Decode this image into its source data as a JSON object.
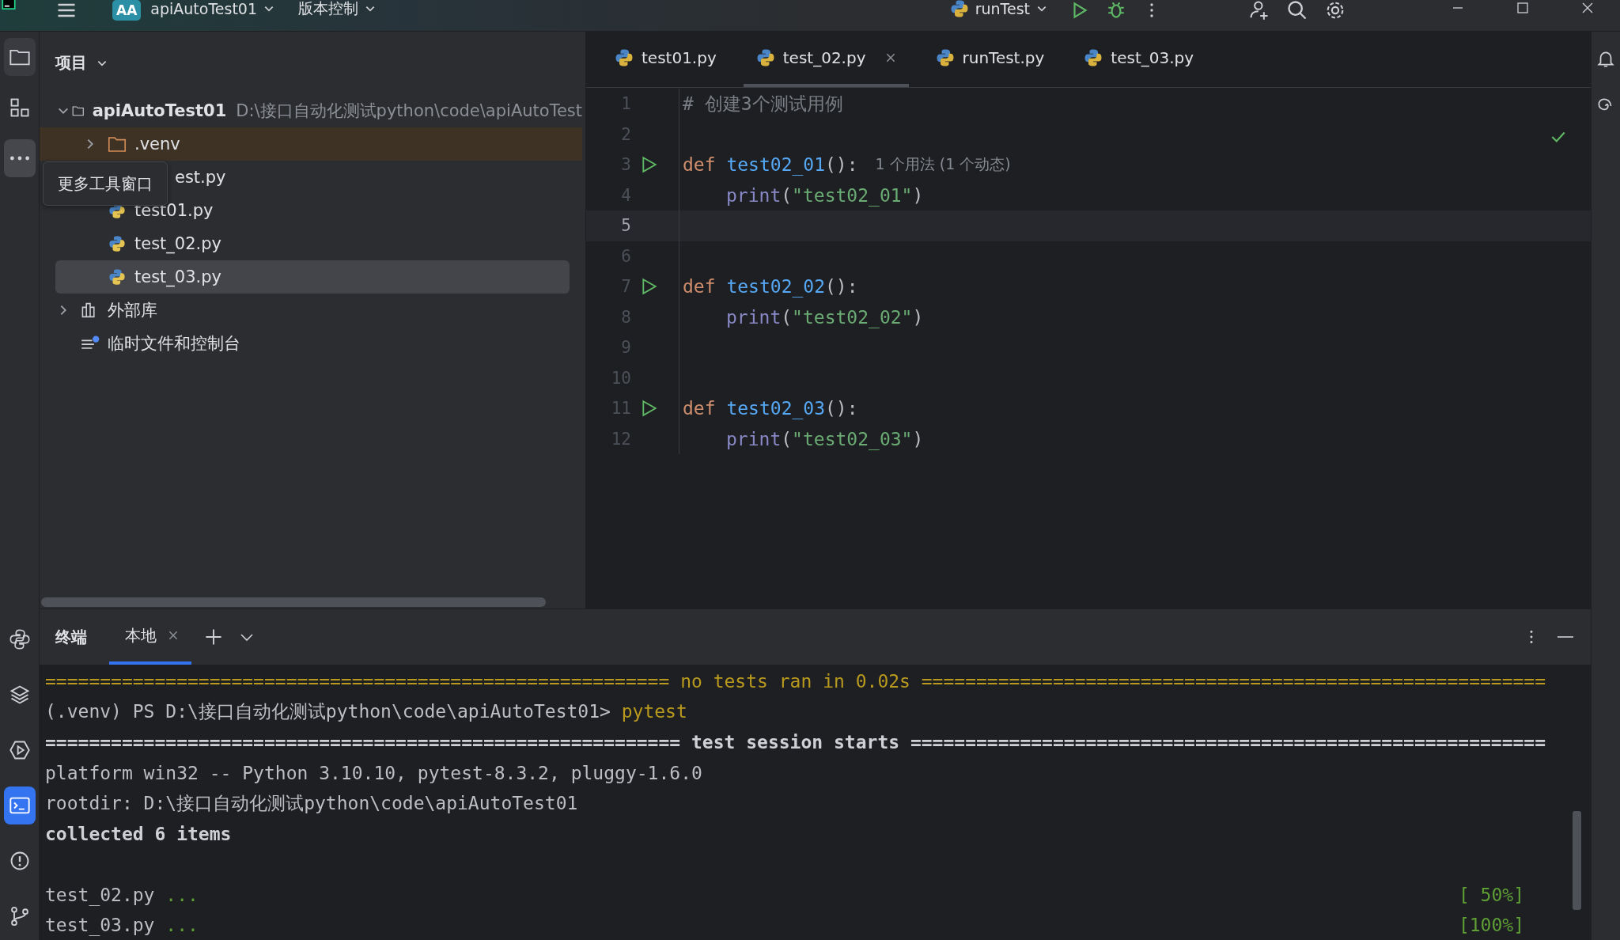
{
  "title_bar": {
    "project_badge": "AA",
    "project": "apiAutoTest01",
    "vcs": "版本控制",
    "run_config": "runTest"
  },
  "tool_strip": {
    "top": [
      {
        "kind": "project",
        "selected": true,
        "hovered": false
      },
      {
        "kind": "structure",
        "selected": false,
        "hovered": false
      },
      {
        "kind": "more",
        "selected": false,
        "hovered": true
      }
    ],
    "bottom": [
      {
        "kind": "python-console",
        "selected": false
      },
      {
        "kind": "layers",
        "selected": false
      },
      {
        "kind": "services",
        "selected": false
      },
      {
        "kind": "terminal",
        "selected": true
      },
      {
        "kind": "problems",
        "selected": false
      },
      {
        "kind": "git",
        "selected": false
      }
    ],
    "tooltip": "更多工具窗口"
  },
  "project": {
    "title": "项目",
    "tree": [
      {
        "label": "apiAutoTest01",
        "path": "D:\\接口自动化测试python\\code\\apiAutoTest",
        "kind": "project",
        "expanded": true,
        "selected": false,
        "children": [
          {
            "label": ".venv",
            "kind": "folder",
            "expanded": false,
            "excluded": true,
            "selected": false
          },
          {
            "label": "est.py",
            "kind": "covered-file",
            "selected": false
          },
          {
            "label": "test01.py",
            "kind": "file",
            "selected": false
          },
          {
            "label": "test_02.py",
            "kind": "file",
            "selected": false
          },
          {
            "label": "test_03.py",
            "kind": "file",
            "selected": true
          }
        ]
      },
      {
        "label": "外部库",
        "kind": "library",
        "expanded": false,
        "selected": false
      },
      {
        "label": "临时文件和控制台",
        "kind": "scratches",
        "selected": false
      }
    ]
  },
  "editor": {
    "tabs": [
      {
        "label": "test01.py",
        "selected": false
      },
      {
        "label": "test_02.py",
        "selected": true
      },
      {
        "label": "runTest.py",
        "selected": false
      },
      {
        "label": "test_03.py",
        "selected": false
      }
    ],
    "lines": [
      {
        "number": "1",
        "tokens": [
          {
            "text": "# 创建3个测试用例",
            "kind": "comment"
          }
        ]
      },
      {
        "number": "2"
      },
      {
        "number": "3",
        "runnable": true,
        "tokens": [
          {
            "text": "def ",
            "kind": "keyword"
          },
          {
            "text": "test02_01",
            "kind": "function"
          },
          {
            "text": "():",
            "kind": "punct"
          }
        ],
        "hint": "1 个用法 (1 个动态)"
      },
      {
        "number": "4",
        "indent": true,
        "tokens": [
          {
            "text": "print",
            "kind": "builtin"
          },
          {
            "text": "(",
            "kind": "punct"
          },
          {
            "text": "\"test02_01\"",
            "kind": "string"
          },
          {
            "text": ")",
            "kind": "punct"
          }
        ]
      },
      {
        "number": "5",
        "current": true
      },
      {
        "number": "6"
      },
      {
        "number": "7",
        "runnable": true,
        "tokens": [
          {
            "text": "def ",
            "kind": "keyword"
          },
          {
            "text": "test02_02",
            "kind": "function"
          },
          {
            "text": "():",
            "kind": "punct"
          }
        ]
      },
      {
        "number": "8",
        "indent": true,
        "tokens": [
          {
            "text": "print",
            "kind": "builtin"
          },
          {
            "text": "(",
            "kind": "punct"
          },
          {
            "text": "\"test02_02\"",
            "kind": "string"
          },
          {
            "text": ")",
            "kind": "punct"
          }
        ]
      },
      {
        "number": "9"
      },
      {
        "number": "10"
      },
      {
        "number": "11",
        "runnable": true,
        "tokens": [
          {
            "text": "def ",
            "kind": "keyword"
          },
          {
            "text": "test02_03",
            "kind": "function"
          },
          {
            "text": "():",
            "kind": "punct"
          }
        ]
      },
      {
        "number": "12",
        "indent": true,
        "tokens": [
          {
            "text": "print",
            "kind": "builtin"
          },
          {
            "text": "(",
            "kind": "punct"
          },
          {
            "text": "\"test02_03\"",
            "kind": "string"
          },
          {
            "text": ")",
            "kind": "punct"
          }
        ]
      }
    ],
    "no_problems": true
  },
  "terminal": {
    "title": "终端",
    "tabs": [
      {
        "label": "本地",
        "selected": true
      }
    ],
    "lines": [
      {
        "kind": "summary",
        "text": "========================================================= no tests ran in 0.02s ========================================================="
      },
      {
        "kind": "prompt",
        "text": "(.venv) PS D:\\接口自动化测试python\\code\\apiAutoTest01> ",
        "command": "pytest"
      },
      {
        "kind": "header",
        "text": "========================================================== test session starts =========================================================="
      },
      {
        "kind": "plain",
        "text": "platform win32 -- Python 3.10.10, pytest-8.3.2, pluggy-1.6.0"
      },
      {
        "kind": "plain",
        "text": "rootdir: D:\\接口自动化测试python\\code\\apiAutoTest01"
      },
      {
        "kind": "header",
        "text": "collected 6 items"
      },
      {
        "kind": "blank"
      },
      {
        "kind": "result",
        "text": "test_02.py ",
        "dots": "...",
        "percent": "[ 50%]"
      },
      {
        "kind": "result",
        "text": "test_03.py ",
        "dots": "...",
        "percent": "[100%]"
      }
    ]
  }
}
